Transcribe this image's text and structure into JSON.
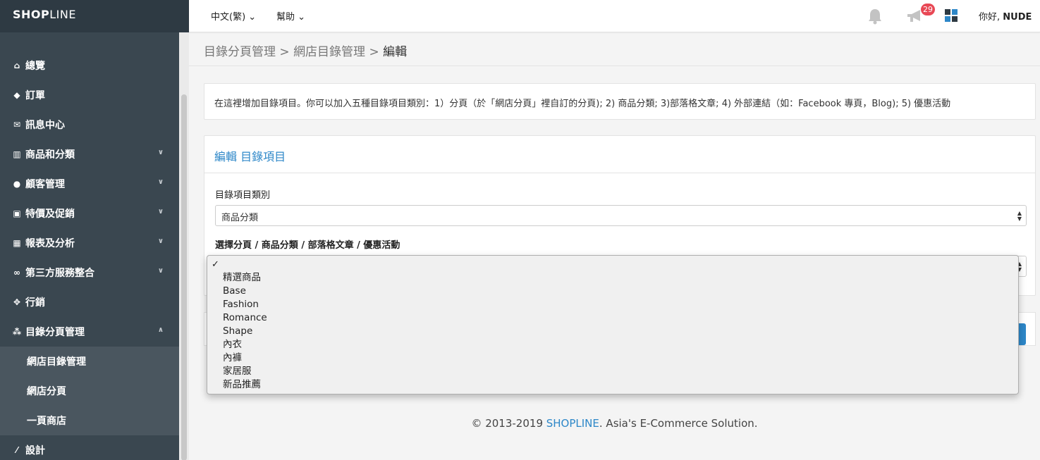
{
  "brand": {
    "logo_bold": "SHOP",
    "logo_o": "O",
    "logo_thin": "LINE",
    "full": "SHOPLINE"
  },
  "topbar": {
    "language": "中文(繁)",
    "help": "幫助",
    "notification_count": "29",
    "greeting": "你好,",
    "username": "NUDE"
  },
  "sidebar": {
    "items": [
      {
        "label": "總覽",
        "icon": "home-icon"
      },
      {
        "label": "訂單",
        "icon": "tag-icon"
      },
      {
        "label": "訊息中心",
        "icon": "envelope-icon"
      },
      {
        "label": "商品和分類",
        "icon": "barcode-icon"
      },
      {
        "label": "顧客管理",
        "icon": "users-icon"
      },
      {
        "label": "特價及促銷",
        "icon": "money-icon"
      },
      {
        "label": "報表及分析",
        "icon": "bar-chart-icon"
      },
      {
        "label": "第三方服務整合",
        "icon": "link-icon"
      },
      {
        "label": "行銷",
        "icon": "arrows-icon"
      },
      {
        "label": "目錄分頁管理",
        "icon": "sitemap-icon"
      }
    ],
    "subitems": [
      {
        "label": "網店目錄管理"
      },
      {
        "label": "網店分頁"
      },
      {
        "label": "一頁商店"
      }
    ],
    "last_item": {
      "label": "設計",
      "icon": "magic-wand-icon"
    }
  },
  "breadcrumb": {
    "part1": "目錄分頁管理",
    "sep": ">",
    "part2": "網店目錄管理",
    "current": "編輯"
  },
  "info_text": "在這裡增加目錄項目。你可以加入五種目錄項目類別：1）分頁（於「網店分頁」裡自訂的分頁); 2) 商品分類; 3)部落格文章; 4) 外部連結（如：Facebook 專頁，Blog); 5) 優惠活動",
  "panel": {
    "title": "編輯 目錄項目",
    "type_label": "目錄項目類別",
    "type_value": "商品分類",
    "select_label": "選擇分頁 / 商品分類 / 部落格文章 / 優惠活動"
  },
  "dropdown_options": [
    "",
    "精選商品",
    "Base",
    "Fashion",
    "Romance",
    "Shape",
    "內衣",
    "內褲",
    "家居服",
    "新品推薦"
  ],
  "footer": {
    "prefix": "© 2013-2019 ",
    "link": "SHOPLINE",
    "suffix": ". Asia's E-Commerce Solution."
  }
}
